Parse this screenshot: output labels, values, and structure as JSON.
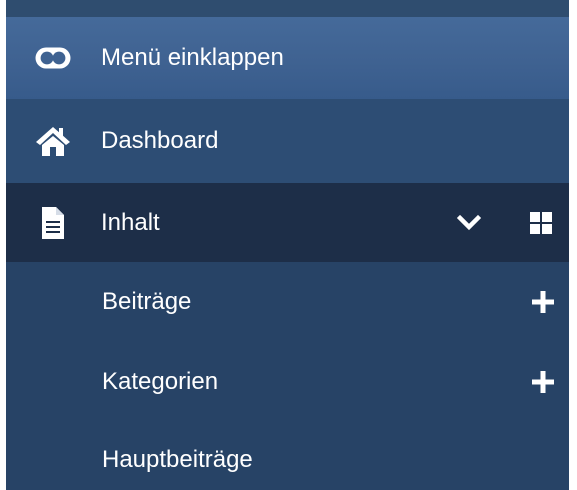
{
  "sidebar": {
    "collapse_item": {
      "label": "Menü einklappen",
      "icon": "toggle-icon"
    },
    "dashboard_item": {
      "label": "Dashboard",
      "icon": "home-icon"
    },
    "content_item": {
      "label": "Inhalt",
      "icon": "file-icon",
      "expand_icon": "chevron-down-icon",
      "action_icon": "grid-icon",
      "expanded": true
    },
    "submenu": [
      {
        "label": "Beiträge",
        "action_icon": "plus-icon"
      },
      {
        "label": "Kategorien",
        "action_icon": "plus-icon"
      },
      {
        "label": "Hauptbeiträge"
      }
    ]
  },
  "colors": {
    "sidebar_background": "#274366",
    "active_row": "#3f6291",
    "dashboard_row": "#2d4d74",
    "expanded_group_row": "#1d2e48",
    "text": "#ffffff"
  }
}
